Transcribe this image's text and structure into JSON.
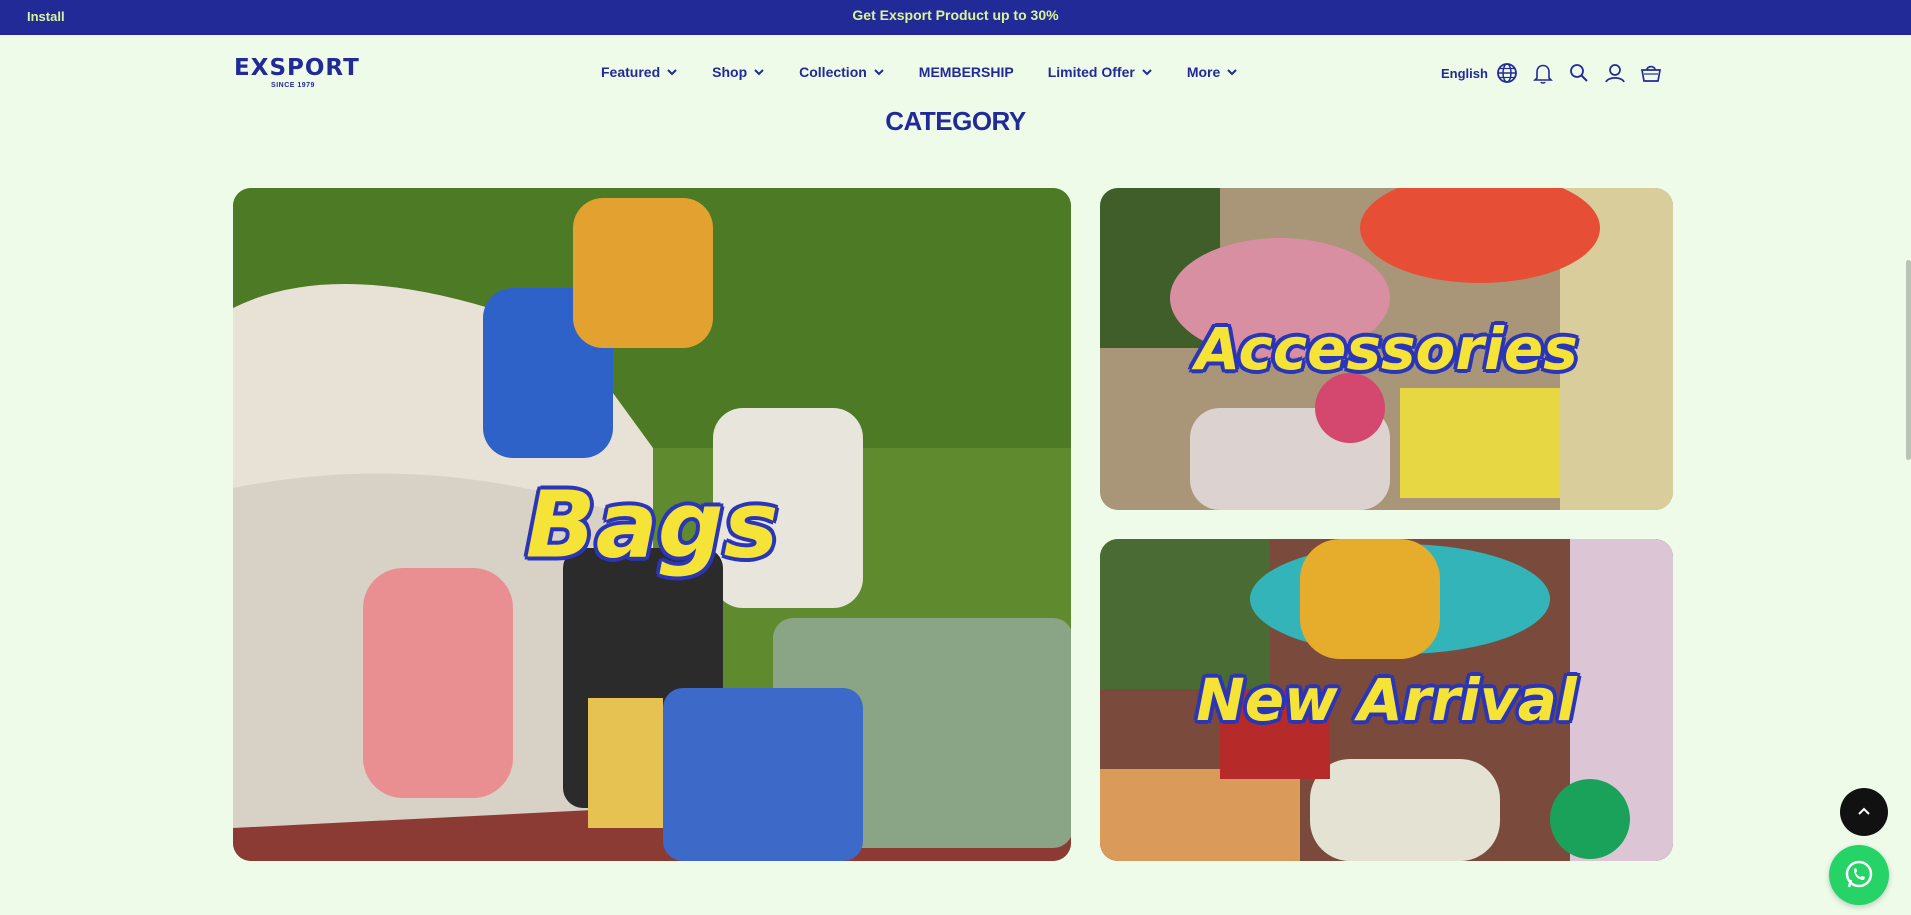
{
  "topbar": {
    "install_label": "Install",
    "promo_text": "Get Exsport Product up to 30%",
    "bg_color": "#222a97",
    "text_color": "#d9f59a"
  },
  "header": {
    "logo_word": "EXSPORT",
    "logo_since": "SINCE 1979",
    "nav": [
      {
        "label": "Featured",
        "has_dropdown": true
      },
      {
        "label": "Shop",
        "has_dropdown": true
      },
      {
        "label": "Collection",
        "has_dropdown": true
      },
      {
        "label": "MEMBERSHIP",
        "has_dropdown": false
      },
      {
        "label": "Limited Offer",
        "has_dropdown": true
      },
      {
        "label": "More",
        "has_dropdown": true
      }
    ],
    "language": "English",
    "icons": [
      "globe-icon",
      "bell-icon",
      "search-icon",
      "user-icon",
      "cart-icon"
    ]
  },
  "section": {
    "title": "CATEGORY"
  },
  "categories": [
    {
      "label": "Bags"
    },
    {
      "label": "Accessories"
    },
    {
      "label": "New Arrival"
    }
  ],
  "colors": {
    "brand": "#222a97",
    "page_bg": "#eefbe9",
    "label_fill": "#f6e337",
    "label_outline": "#2b35b8",
    "whatsapp": "#25d366"
  }
}
